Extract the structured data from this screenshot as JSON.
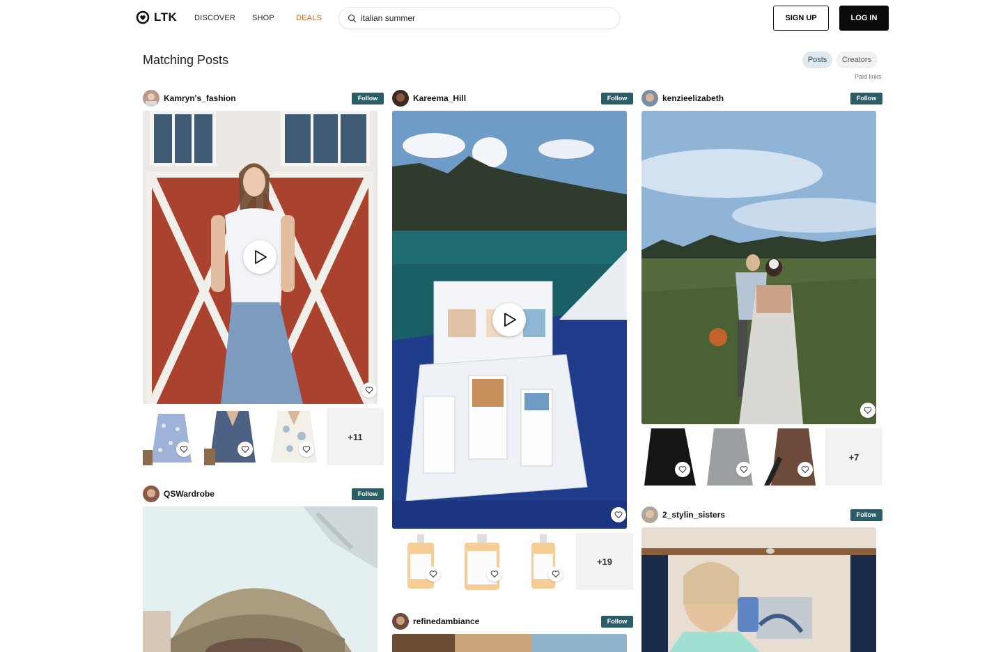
{
  "header": {
    "logo_text": "LTK",
    "nav": [
      "DISCOVER",
      "SHOP",
      "DEALS"
    ],
    "search_value": "italian summer",
    "signup_label": "SIGN UP",
    "login_label": "LOG IN"
  },
  "main": {
    "title": "Matching Posts",
    "tabs": [
      "Posts",
      "Creators"
    ],
    "active_tab": "Posts",
    "paid_links": "Paid links"
  },
  "posts": [
    {
      "username": "Kamryn's_fashion",
      "follow_label": "Follow",
      "has_video": true,
      "more_count": "+11"
    },
    {
      "username": "Kareema_Hill",
      "follow_label": "Follow",
      "has_video": true,
      "more_count": "+19"
    },
    {
      "username": "kenzieelizabeth",
      "follow_label": "Follow",
      "has_video": false,
      "more_count": "+7"
    },
    {
      "username": "QSWardrobe",
      "follow_label": "Follow"
    },
    {
      "username": "refinedambiance",
      "follow_label": "Follow"
    },
    {
      "username": "2_stylin_sisters",
      "follow_label": "Follow"
    }
  ],
  "colors": {
    "follow_bg": "#2b5d66",
    "deals": "#c46a1a",
    "active_tab_bg": "#dfe8ee"
  }
}
